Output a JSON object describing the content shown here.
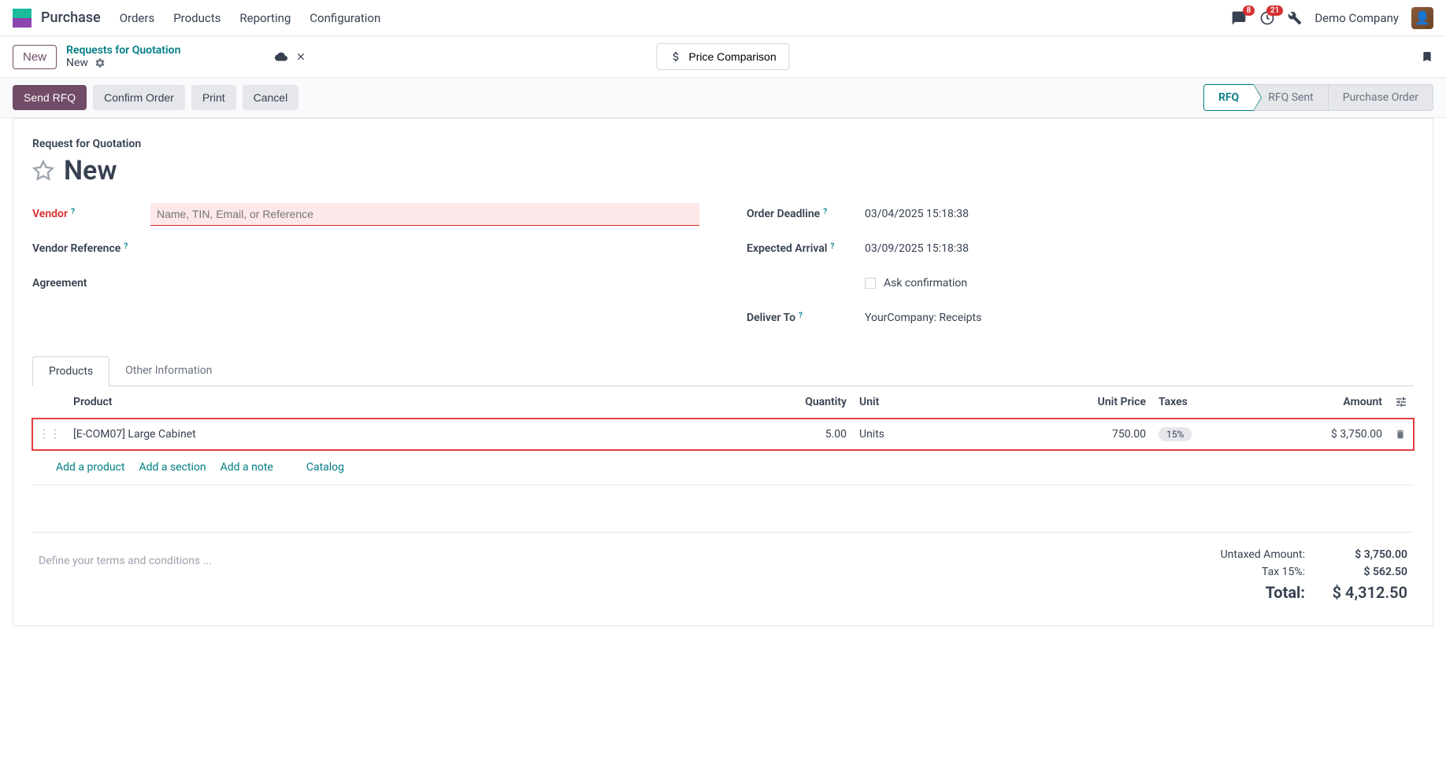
{
  "nav": {
    "app": "Purchase",
    "menu": [
      "Orders",
      "Products",
      "Reporting",
      "Configuration"
    ],
    "messages_badge": "8",
    "activities_badge": "21",
    "company": "Demo Company"
  },
  "breadcrumb": {
    "new_btn": "New",
    "parent": "Requests for Quotation",
    "current": "New",
    "price_comparison": "Price Comparison"
  },
  "actions": {
    "send_rfq": "Send RFQ",
    "confirm": "Confirm Order",
    "print": "Print",
    "cancel": "Cancel"
  },
  "status": {
    "rfq": "RFQ",
    "sent": "RFQ Sent",
    "po": "Purchase Order"
  },
  "form": {
    "title_small": "Request for Quotation",
    "title": "New",
    "vendor_label": "Vendor",
    "vendor_placeholder": "Name, TIN, Email, or Reference",
    "vendor_ref_label": "Vendor Reference",
    "agreement_label": "Agreement",
    "deadline_label": "Order Deadline",
    "deadline_value": "03/04/2025 15:18:38",
    "arrival_label": "Expected Arrival",
    "arrival_value": "03/09/2025 15:18:38",
    "ask_confirmation": "Ask confirmation",
    "deliver_to_label": "Deliver To",
    "deliver_to_value": "YourCompany: Receipts"
  },
  "tabs": {
    "products": "Products",
    "other": "Other Information"
  },
  "table": {
    "headers": {
      "product": "Product",
      "quantity": "Quantity",
      "unit": "Unit",
      "unit_price": "Unit Price",
      "taxes": "Taxes",
      "amount": "Amount"
    },
    "rows": [
      {
        "product": "[E-COM07] Large Cabinet",
        "quantity": "5.00",
        "unit": "Units",
        "unit_price": "750.00",
        "taxes": "15%",
        "amount": "$ 3,750.00"
      }
    ],
    "add_product": "Add a product",
    "add_section": "Add a section",
    "add_note": "Add a note",
    "catalog": "Catalog"
  },
  "footer": {
    "terms_placeholder": "Define your terms and conditions ...",
    "untaxed_label": "Untaxed Amount:",
    "untaxed_value": "$ 3,750.00",
    "tax_label": "Tax 15%:",
    "tax_value": "$ 562.50",
    "total_label": "Total:",
    "total_value": "$ 4,312.50"
  }
}
